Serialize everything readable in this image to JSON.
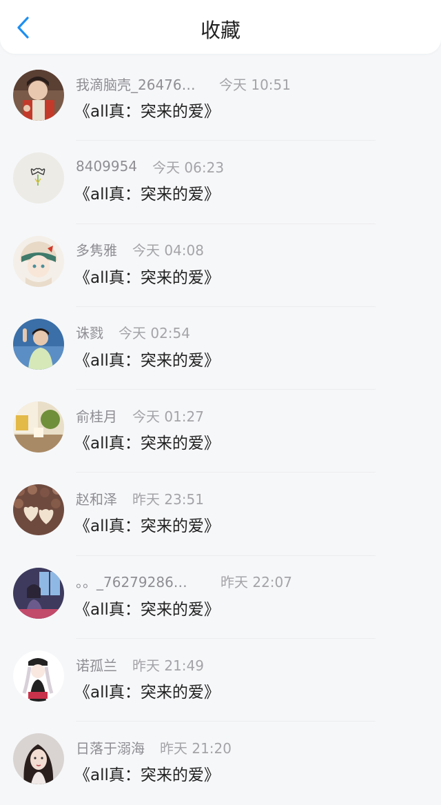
{
  "header": {
    "title": "收藏",
    "back_icon": "chevron-left-icon",
    "accent": "#1e8ff0"
  },
  "items": [
    {
      "name": "我滴脑壳_26476…",
      "time": "今天 10:51",
      "title": "《all真：突来的爱》",
      "avatar": "a1"
    },
    {
      "name": "8409954",
      "time": "今天 06:23",
      "title": "《all真：突来的爱》",
      "avatar": "a2"
    },
    {
      "name": "多隽雅",
      "time": "今天 04:08",
      "title": "《all真：突来的爱》",
      "avatar": "a3"
    },
    {
      "name": "诛戮",
      "time": "今天 02:54",
      "title": "《all真：突来的爱》",
      "avatar": "a4"
    },
    {
      "name": "俞桂月",
      "time": "今天 01:27",
      "title": "《all真：突来的爱》",
      "avatar": "a5"
    },
    {
      "name": "赵和泽",
      "time": "昨天 23:51",
      "title": "《all真：突来的爱》",
      "avatar": "a6"
    },
    {
      "name": "。。_76279286…",
      "time": "昨天 22:07",
      "title": "《all真：突来的爱》",
      "avatar": "a7"
    },
    {
      "name": "诺孤兰",
      "time": "昨天 21:49",
      "title": "《all真：突来的爱》",
      "avatar": "a8"
    },
    {
      "name": "日落于溺海",
      "time": "昨天 21:20",
      "title": "《all真：突来的爱》",
      "avatar": "a9"
    }
  ]
}
